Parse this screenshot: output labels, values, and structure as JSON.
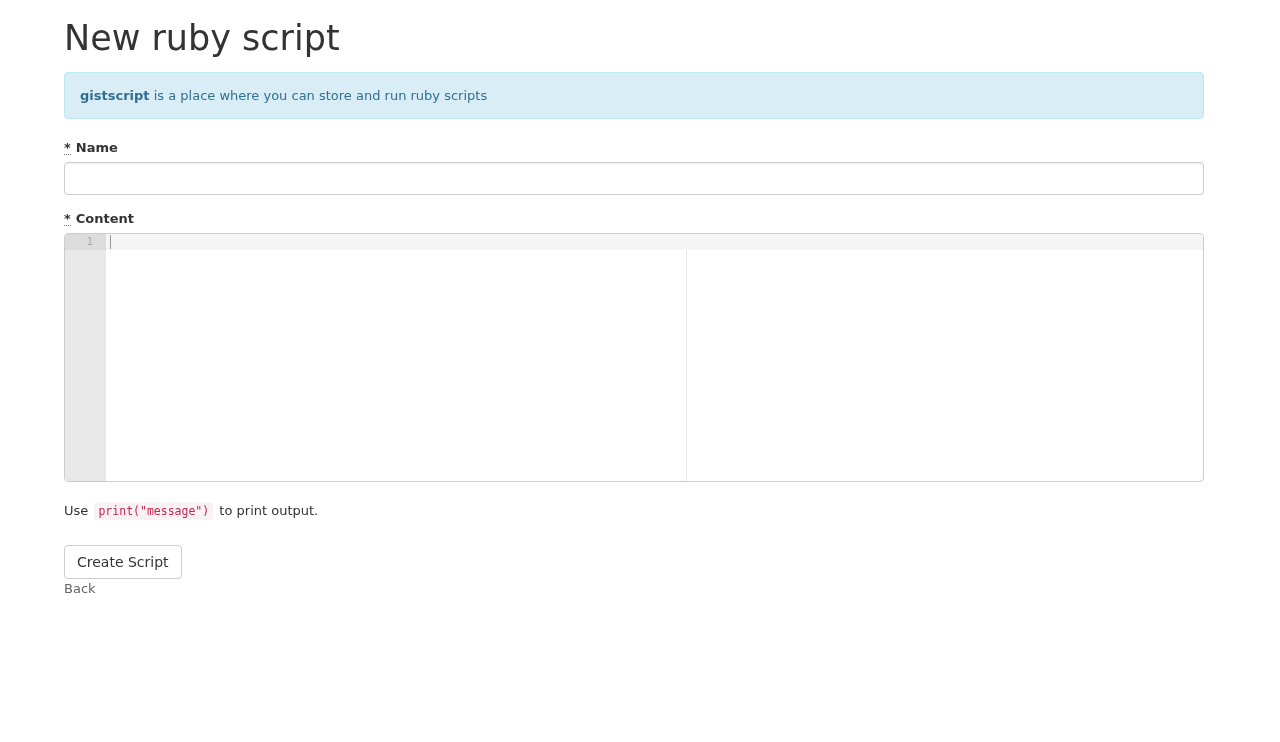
{
  "title": "New ruby script",
  "notice": {
    "text": "**gistscript** is a place where you can store and run ruby scripts"
  },
  "fields": [
    {
      "kind": "text",
      "required_mark": "*",
      "label": "Name"
    },
    {
      "kind": "code",
      "required_mark": "*",
      "label": "Content",
      "lines": [
        {
          "number": "1",
          "active": true
        }
      ]
    }
  ],
  "hint": {
    "before": "Use",
    "code": "print(\"message\")",
    "after": "to print output."
  },
  "submit_button": "Create Script",
  "back_link": "Back"
}
